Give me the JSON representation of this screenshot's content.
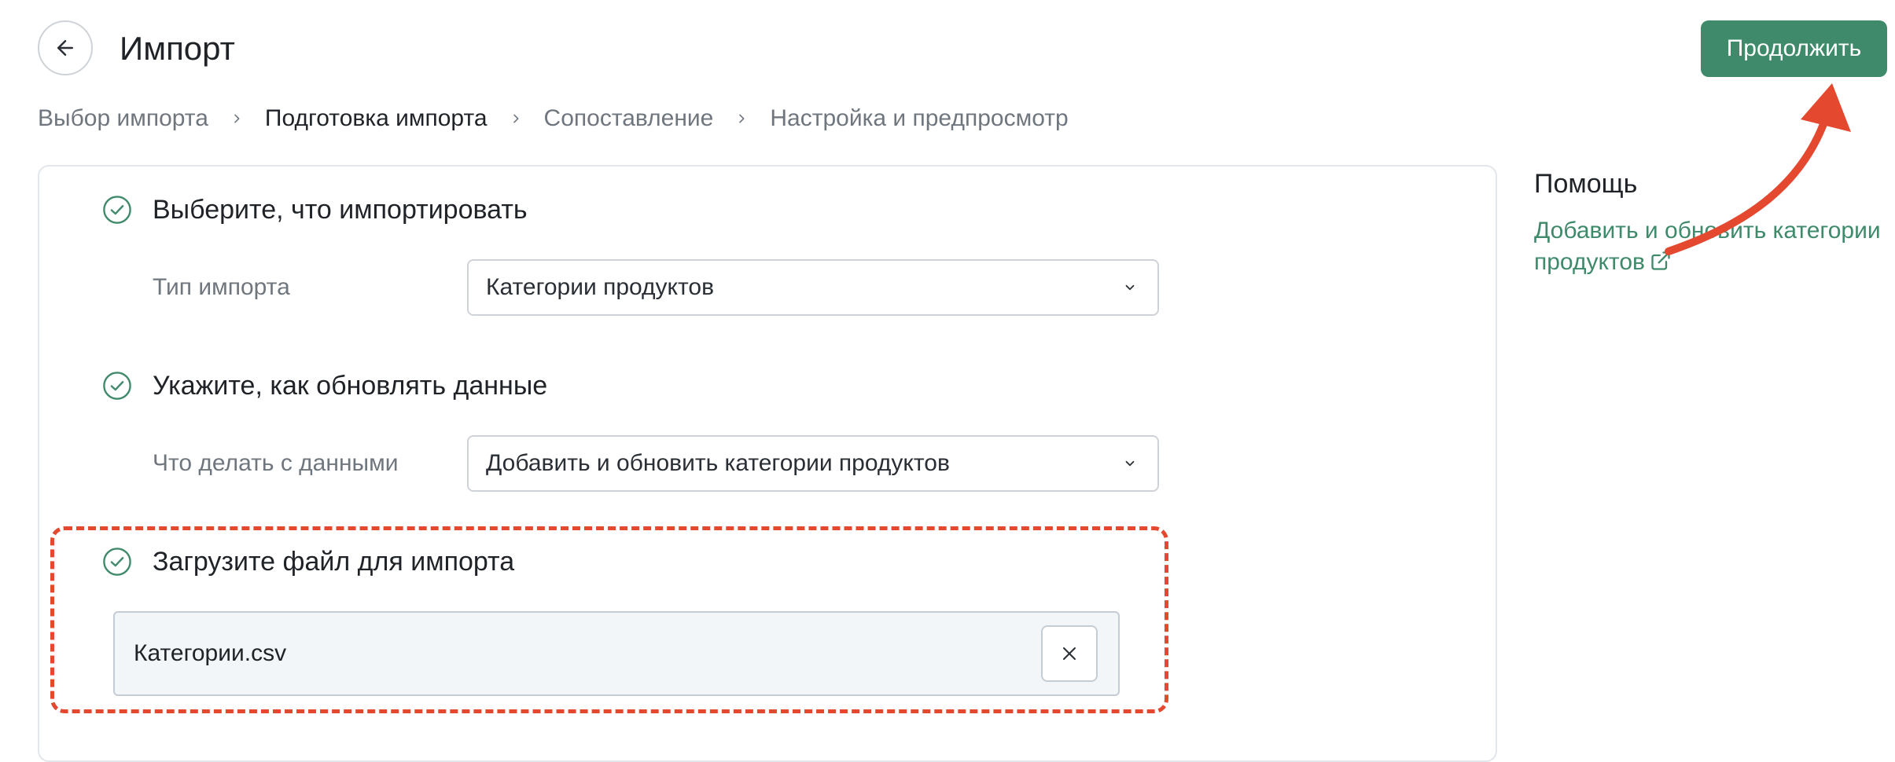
{
  "header": {
    "title": "Импорт",
    "continue_label": "Продолжить"
  },
  "breadcrumbs": [
    {
      "label": "Выбор импорта",
      "active": false
    },
    {
      "label": "Подготовка импорта",
      "active": true
    },
    {
      "label": "Сопоставление",
      "active": false
    },
    {
      "label": "Настройка и предпросмотр",
      "active": false
    }
  ],
  "steps": {
    "select_type": {
      "title": "Выберите, что импортировать",
      "field_label": "Тип импорта",
      "value": "Категории продуктов"
    },
    "update_mode": {
      "title": "Укажите, как обновлять данные",
      "field_label": "Что делать с данными",
      "value": "Добавить и обновить категории продуктов"
    },
    "upload": {
      "title": "Загрузите файл для импорта",
      "file_name": "Категории.csv"
    }
  },
  "help": {
    "title": "Помощь",
    "link_text": "Добавить и обновить категории продуктов"
  },
  "colors": {
    "accent": "#3e8a6a",
    "annotation": "#e4492f"
  },
  "icons": {
    "back": "arrow-left-icon",
    "step_done": "check-circle-icon",
    "dropdown": "chevron-down-icon",
    "remove": "close-icon",
    "external": "external-link-icon",
    "separator": "chevron-right-icon"
  }
}
